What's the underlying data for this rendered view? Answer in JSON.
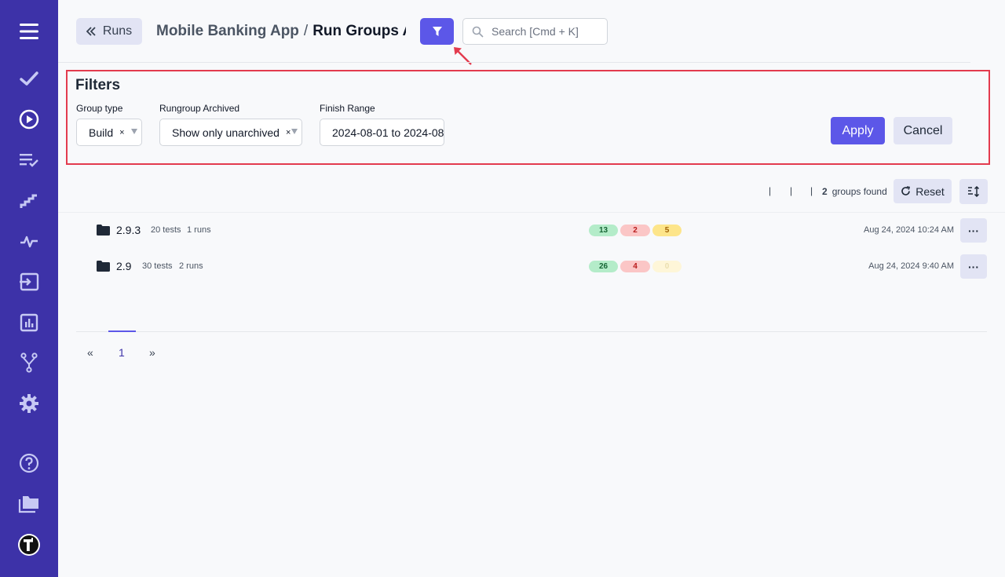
{
  "header": {
    "back_label": "Runs",
    "project": "Mobile Banking App",
    "separator": "/",
    "current": "Run Groups Arc",
    "search_placeholder": "Search [Cmd + K]"
  },
  "sidebar": {
    "icons": [
      "menu-icon",
      "checkmark-icon",
      "play-circle-icon",
      "checklist-icon",
      "steps-icon",
      "pulse-icon",
      "import-icon",
      "analytics-icon",
      "branch-icon",
      "settings-icon",
      "help-icon",
      "folders-icon",
      "logo-icon"
    ]
  },
  "filters": {
    "title": "Filters",
    "group_type": {
      "label": "Group type",
      "value": "Build",
      "clear": "×"
    },
    "archived": {
      "label": "Rungroup Archived",
      "value": "Show only unarchived",
      "clear": "×"
    },
    "finish_range": {
      "label": "Finish Range",
      "value": "2024-08-01 to 2024-08-"
    },
    "apply_label": "Apply",
    "cancel_label": "Cancel"
  },
  "toolbar": {
    "pipe": "|",
    "count": "2",
    "found_label": "groups found",
    "reset_label": "Reset"
  },
  "groups": [
    {
      "name": "2.9.3",
      "tests": "20 tests",
      "runs": "1 runs",
      "passed": "13",
      "failed": "2",
      "skipped": "5",
      "date": "Aug 24, 2024 10:24 AM",
      "more": "···"
    },
    {
      "name": "2.9",
      "tests": "30 tests",
      "runs": "2 runs",
      "passed": "26",
      "failed": "4",
      "skipped": "0",
      "date": "Aug 24, 2024 9:40 AM",
      "more": "···"
    }
  ],
  "pagination": {
    "prev": "«",
    "page": "1",
    "next": "»"
  },
  "colors": {
    "sidebar": "#3d32a8",
    "accent": "#5c57e8",
    "highlight": "#e33b4e"
  }
}
